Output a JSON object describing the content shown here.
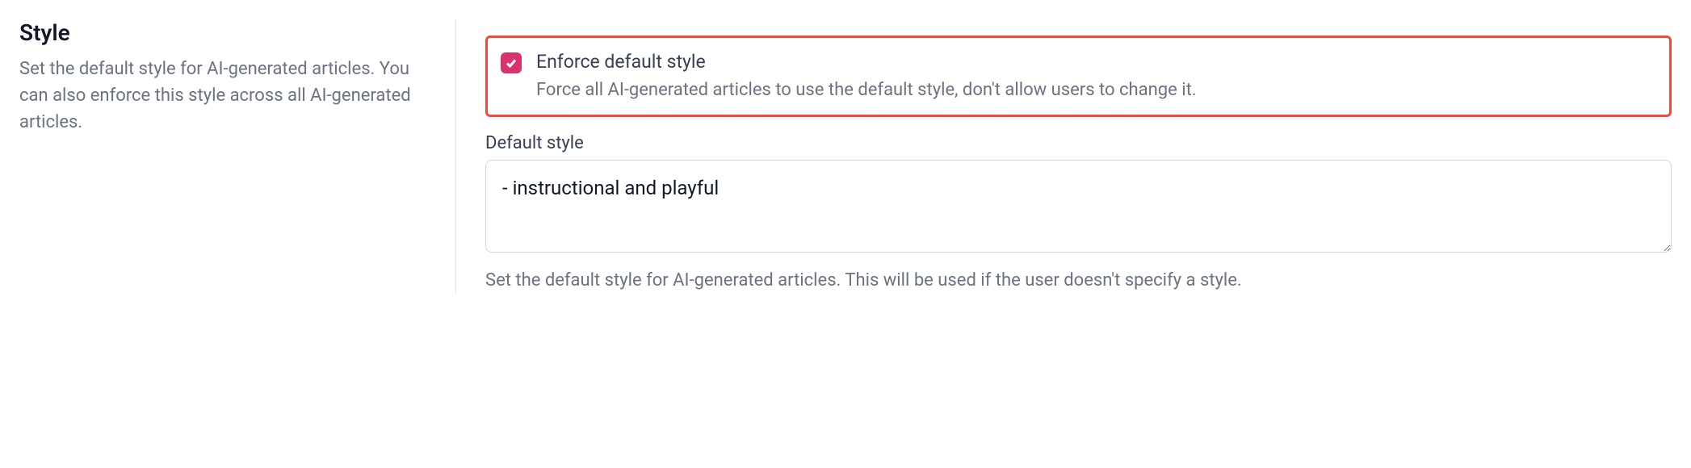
{
  "section": {
    "title": "Style",
    "description": "Set the default style for AI-generated articles. You can also enforce this style across all AI-generated articles."
  },
  "enforce": {
    "label": "Enforce default style",
    "description": "Force all AI-generated articles to use the default style, don't allow users to change it.",
    "checked": true
  },
  "defaultStyle": {
    "label": "Default style",
    "value": "- instructional and playful",
    "help": "Set the default style for AI-generated articles. This will be used if the user doesn't specify a style."
  }
}
